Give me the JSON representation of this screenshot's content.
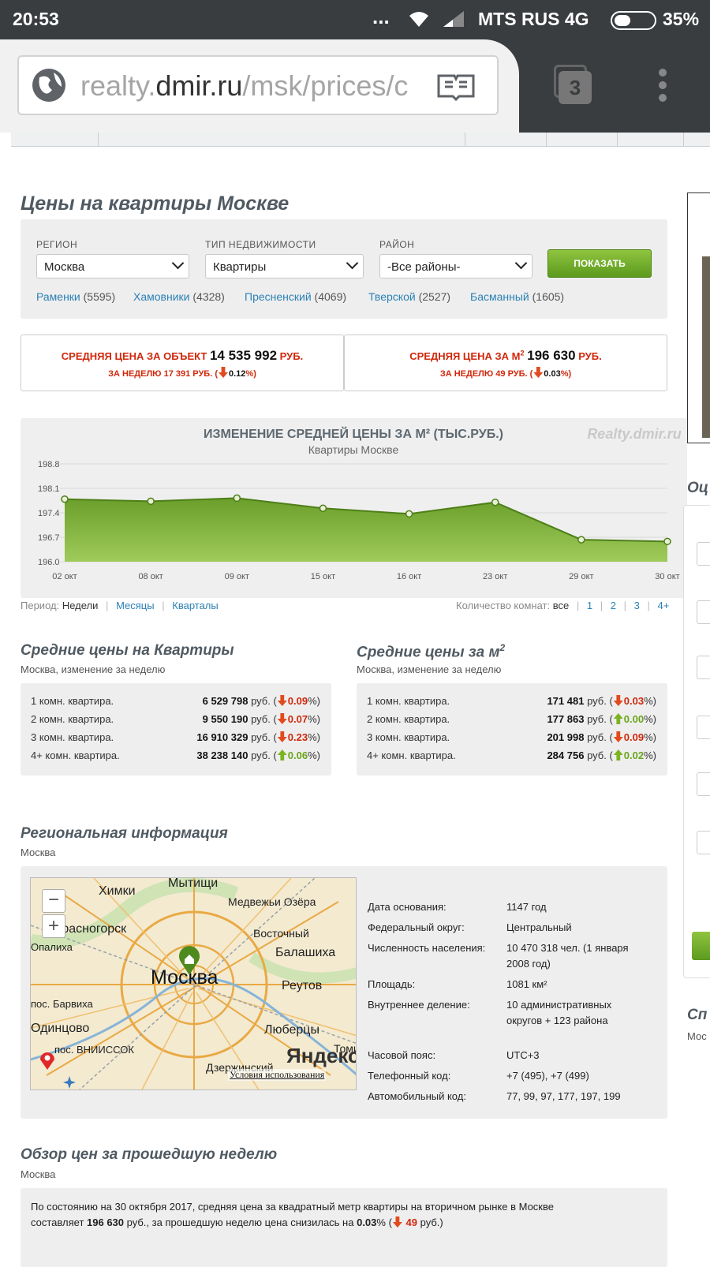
{
  "status_bar": {
    "time": "20:53",
    "dots": "...",
    "carrier": "MTS RUS 4G",
    "battery": "35%"
  },
  "browser": {
    "url_prefix": "realty.",
    "url_domain": "dmir.ru",
    "url_path": "/msk/prices/c",
    "tab_count": "3"
  },
  "page": {
    "title": "Цены на квартиры Москве"
  },
  "filters": {
    "region_label": "РЕГИОН",
    "region_value": "Москва",
    "type_label": "ТИП НЕДВИЖИМОСТИ",
    "type_value": "Квартиры",
    "district_label": "РАЙОН",
    "district_value": "-Все районы-",
    "show_button": "ПОКАЗАТЬ",
    "districts": [
      {
        "name": "Раменки",
        "count": "(5595)"
      },
      {
        "name": "Хамовники",
        "count": "(4328)"
      },
      {
        "name": "Пресненский",
        "count": "(4069)"
      },
      {
        "name": "Тверской",
        "count": "(2527)"
      },
      {
        "name": "Басманный",
        "count": "(1605)"
      }
    ]
  },
  "summary": {
    "object": {
      "label": "СРЕДНЯЯ ЦЕНА ЗА ОБЪЕКТ",
      "value": "14 535 992",
      "unit": "РУБ.",
      "week_label": "ЗА НЕДЕЛЮ 17 391 РУБ. (",
      "week_pct": "0.12",
      "week_suffix": "%)"
    },
    "sqm": {
      "label": "СРЕДНЯЯ ЦЕНА ЗА М",
      "sup": "2",
      "value": "196 630",
      "unit": "РУБ.",
      "week_label": "ЗА НЕДЕЛЮ 49 РУБ. (",
      "week_pct": "0.03",
      "week_suffix": "%)"
    }
  },
  "chart_data": {
    "type": "area",
    "title": "ИЗМЕНЕНИЕ СРЕДНЕЙ ЦЕНЫ ЗА М² (ТЫС.РУБ.)",
    "subtitle": "Квартиры Москве",
    "watermark": "Realty.dmir.ru",
    "categories": [
      "02 окт",
      "08 окт",
      "09 окт",
      "15 окт",
      "16 окт",
      "23 окт",
      "29 окт",
      "30 окт"
    ],
    "values": [
      197.79,
      197.73,
      197.82,
      197.53,
      197.37,
      197.7,
      196.63,
      196.58
    ],
    "yticks": [
      "198.8",
      "198.1",
      "197.4",
      "196.7",
      "196.0"
    ],
    "ylim": [
      196.0,
      198.8
    ],
    "grid": true,
    "colors": {
      "fill_top": "#6a9e2a",
      "fill_bottom": "#9fcb5a",
      "line": "#4e7f18"
    }
  },
  "period": {
    "label": "Период:",
    "current": "Недели",
    "months": "Месяцы",
    "quarters": "Кварталы",
    "rooms_label": "Количество комнат:",
    "rooms_current": "все",
    "rooms": [
      "1",
      "2",
      "3",
      "4+"
    ]
  },
  "avg_flat": {
    "title": "Средние цены на Квартиры",
    "subtitle": "Москва, изменение за неделю",
    "rows": [
      {
        "name": "1 комн. квартира.",
        "value": "6 529 798",
        "unit": " руб. (",
        "pct": "0.09",
        "dir": "down"
      },
      {
        "name": "2 комн. квартира.",
        "value": "9 550 190",
        "unit": " руб. (",
        "pct": "0.07",
        "dir": "down"
      },
      {
        "name": "3 комн. квартира.",
        "value": "16 910 329",
        "unit": " руб. (",
        "pct": "0.23",
        "dir": "down"
      },
      {
        "name": "4+ комн. квартира.",
        "value": "38 238 140",
        "unit": " руб. (",
        "pct": "0.06",
        "dir": "up"
      }
    ]
  },
  "avg_sqm": {
    "title": "Средние цены за м",
    "sup": "2",
    "subtitle": "Москва, изменение за неделю",
    "rows": [
      {
        "name": "1 комн. квартира.",
        "value": "171 481",
        "unit": " руб. (",
        "pct": "0.03",
        "dir": "down"
      },
      {
        "name": "2 комн. квартира.",
        "value": "177 863",
        "unit": " руб. (",
        "pct": "0.00",
        "dir": "up"
      },
      {
        "name": "3 комн. квартира.",
        "value": "201 998",
        "unit": " руб. (",
        "pct": "0.09",
        "dir": "down"
      },
      {
        "name": "4+ комн. квартира.",
        "value": "284 756",
        "unit": " руб. (",
        "pct": "0.02",
        "dir": "up"
      }
    ]
  },
  "region": {
    "title": "Региональная информация",
    "subtitle": "Москва",
    "map": {
      "city": "Москва",
      "labels": [
        "Химки",
        "Мытищи",
        "Медвежьи Озёра",
        "Восточный",
        "Балашиха",
        "Реутов",
        "Люберцы",
        "Одинцово",
        "пос. Барвиха",
        "Опалиха",
        "Красногорск",
        "пос. ВНИИССОК",
        "Дзержинский",
        "Томил"
      ],
      "brand": "Яндекс",
      "terms": "Условия использования"
    },
    "facts": [
      {
        "k": "Дата основания:",
        "v": "1147 год"
      },
      {
        "k": "Федеральный округ:",
        "v": "Центральный"
      },
      {
        "k": "Численность населения:",
        "v": "10 470 318 чел. (1 января 2008 год)"
      },
      {
        "k": "Площадь:",
        "v": "1081 км²"
      },
      {
        "k": "Внутреннее деление:",
        "v": "10 административных округов + 123 района"
      },
      {
        "k": "Часовой пояс:",
        "v": "UTC+3"
      },
      {
        "k": "Телефонный код:",
        "v": "+7 (495), +7 (499)"
      },
      {
        "k": "Автомобильный код:",
        "v": "77, 99, 97, 177, 197, 199"
      }
    ]
  },
  "review": {
    "title": "Обзор цен за прошедшую неделю",
    "subtitle": "Москва",
    "text1": "По состоянию на 30 октября 2017, средняя цена за квадратный метр квартиры на вторичном рынке в Москве",
    "text2a": "составляет ",
    "text2b": "196 630",
    "text2c": " руб., за прошедшую неделю цена снизилась на ",
    "text2d": "0.03",
    "text2e": "% (",
    "text2f": "49",
    "text2g": " руб.)"
  },
  "side": {
    "a": "Оц",
    "b": "Сп",
    "c": "Мос"
  }
}
